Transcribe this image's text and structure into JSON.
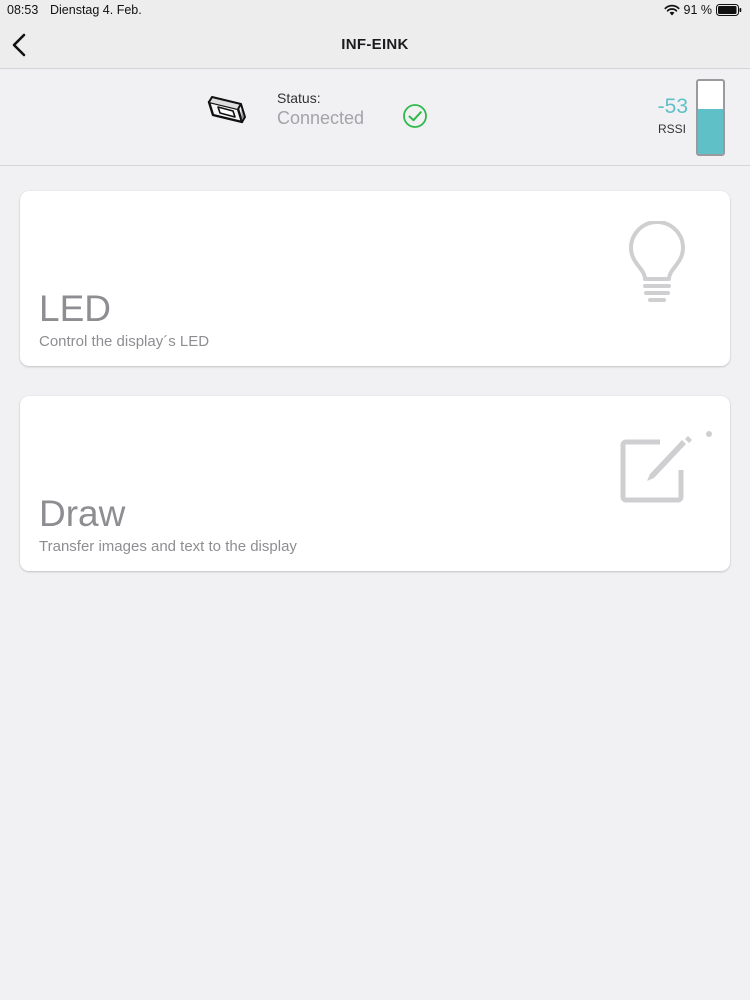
{
  "statusbar": {
    "time": "08:53",
    "date": "Dienstag 4. Feb.",
    "battery": "91 %",
    "icons": [
      "wifi-icon",
      "battery-icon"
    ]
  },
  "nav": {
    "title": "INF-EINK",
    "back_icon": "chevron-left-icon"
  },
  "device": {
    "icon": "eink-display-icon",
    "status_label": "Status:",
    "status_value": "Connected",
    "status_icon": "check-circle-icon",
    "rssi_value": "-53",
    "rssi_label": "RSSI",
    "rssi_level": 0.62,
    "accent_color": "#5fc0c8",
    "ok_color": "#2fb84a"
  },
  "cards": [
    {
      "title": "LED",
      "subtitle": "Control the display´s LED",
      "icon": "lightbulb-icon"
    },
    {
      "title": "Draw",
      "subtitle": "Transfer images and text to the display",
      "icon": "edit-icon"
    }
  ]
}
